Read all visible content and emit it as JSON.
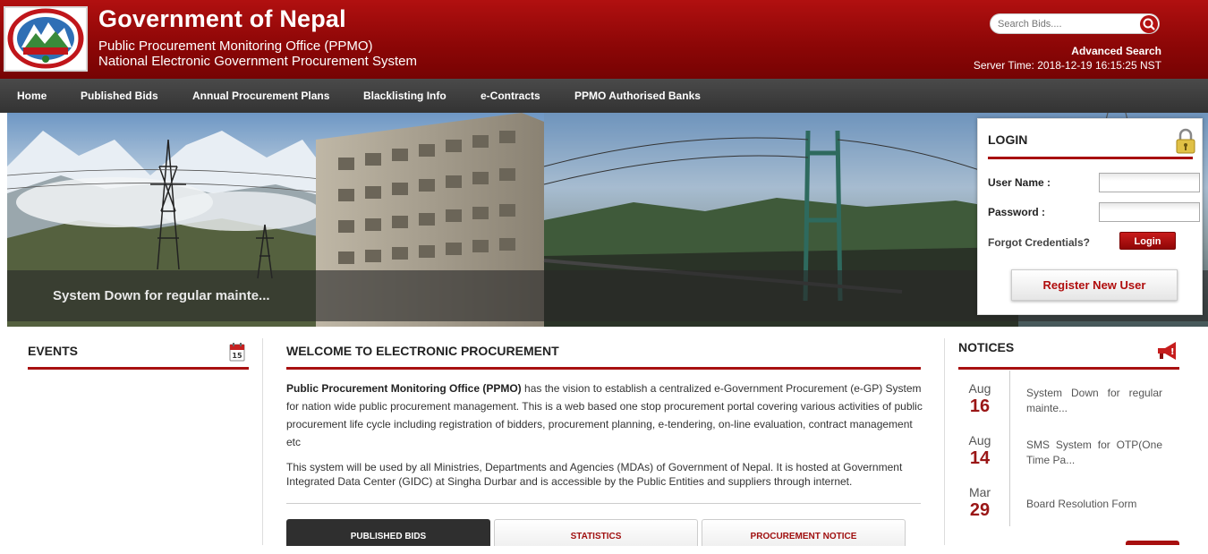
{
  "header": {
    "title": "Government of Nepal",
    "subtitle1": "Public Procurement Monitoring Office (PPMO)",
    "subtitle2": "National Electronic Government Procurement System",
    "search_placeholder": "Search Bids....",
    "advanced_search": "Advanced Search",
    "server_time": "Server Time: 2018-12-19 16:15:25 NST"
  },
  "nav": {
    "items": [
      "Home",
      "Published Bids",
      "Annual Procurement Plans",
      "Blacklisting Info",
      "e-Contracts",
      "PPMO Authorised Banks"
    ]
  },
  "banner": {
    "caption": "System Down for regular mainte..."
  },
  "login": {
    "title": "LOGIN",
    "username_label": "User Name :",
    "password_label": "Password :",
    "username_value": "",
    "password_value": "",
    "forgot": "Forgot Credentials?",
    "login_button": "Login",
    "register_button": "Register New User"
  },
  "events": {
    "title": "EVENTS",
    "calendar_day": "15"
  },
  "welcome": {
    "title": "WELCOME TO ELECTRONIC PROCUREMENT",
    "para1_bold": "Public Procurement Monitoring Office (PPMO)",
    "para1_rest": " has the vision to establish a centralized e-Government Procurement (e-GP) System for nation wide public procurement management. This is a web based one stop procurement portal covering various activities of public procurement life cycle including registration of bidders, procurement planning, e-tendering, on-line evaluation, contract management etc",
    "para2": "This system will be used by all Ministries, Departments and Agencies (MDAs) of Government of Nepal. It is hosted at Government Integrated Data Center (GIDC) at Singha Durbar and is accessible by the Public Entities and suppliers through internet.",
    "tabs": [
      "PUBLISHED BIDS",
      "STATISTICS",
      "PROCUREMENT NOTICE"
    ]
  },
  "notices": {
    "title": "NOTICES",
    "items": [
      {
        "month": "Aug",
        "day": "16",
        "text": "System Down for regular mainte..."
      },
      {
        "month": "Aug",
        "day": "14",
        "text": "SMS System for OTP(One Time Pa..."
      },
      {
        "month": "Mar",
        "day": "29",
        "text": "Board Resolution Form"
      }
    ]
  },
  "colors": {
    "brand_red": "#a81010",
    "nav_bg": "#3a3a3a"
  }
}
